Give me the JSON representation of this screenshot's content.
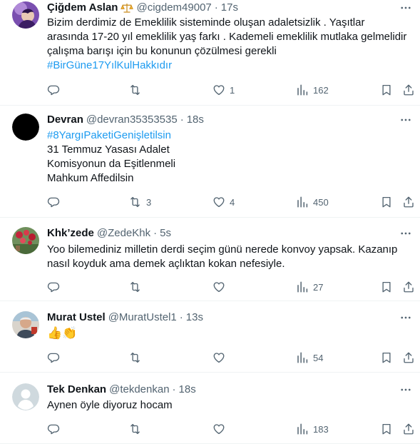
{
  "tweets": [
    {
      "name": "Çiğdem Aslan",
      "handle": "@cigdem49007",
      "time": "17s",
      "badge": "scales-icon",
      "avatar": "photo-purple",
      "lines": [
        {
          "text": "Bizim derdimiz de Emeklilik sisteminde oluşan adaletsizlik . Yaşıtlar",
          "tag": false
        },
        {
          "text": "arasında 17-20 yıl emeklilik yaş farkı . Kademeli emeklilik mutlaka gelmelidir",
          "tag": false
        },
        {
          "text": "çalışma barışı için bu konunun çözülmesi gerekli",
          "tag": false
        },
        {
          "text": "#BirGüne17YılKulHakkıdır",
          "tag": true
        }
      ],
      "replies": "",
      "retweets": "",
      "likes": "1",
      "views": "162"
    },
    {
      "name": "Devran",
      "handle": "@devran35353535",
      "time": "18s",
      "avatar": "black-circle",
      "lines": [
        {
          "text": "#8YargıPaketiGenişletilsin",
          "tag": true
        },
        {
          "text": "31 Temmuz Yasası Adalet",
          "tag": false
        },
        {
          "text": "Komisyonun da Eşitlenmeli",
          "tag": false
        },
        {
          "text": "Mahkum Affedilsin",
          "tag": false
        }
      ],
      "replies": "",
      "retweets": "3",
      "likes": "4",
      "views": "450"
    },
    {
      "name": "Khk’zede",
      "handle": "@ZedeKhk",
      "time": "5s",
      "avatar": "photo-flowers",
      "lines": [
        {
          "text": "Yoo bilemediniz milletin derdi seçim günü nerede konvoy yapsak. Kazanıp",
          "tag": false
        },
        {
          "text": "nasıl koyduk ama demek açlıktan kokan nefesiyle.",
          "tag": false
        }
      ],
      "replies": "",
      "retweets": "",
      "likes": "",
      "views": "27"
    },
    {
      "name": "Murat Ustel",
      "handle": "@MuratUstel1",
      "time": "13s",
      "avatar": "photo-man",
      "lines": [
        {
          "text": "👍👏",
          "tag": false
        }
      ],
      "replies": "",
      "retweets": "",
      "likes": "",
      "views": "54"
    },
    {
      "name": "Tek Denkan",
      "handle": "@tekdenkan",
      "time": "18s",
      "avatar": "default-profile",
      "lines": [
        {
          "text": "Aynen öyle diyoruz hocam",
          "tag": false
        }
      ],
      "replies": "",
      "retweets": "",
      "likes": "",
      "views": "183"
    }
  ],
  "icons": {
    "more": "more-dots-icon",
    "reply": "reply-icon",
    "retweet": "retweet-icon",
    "like": "heart-icon",
    "views": "analytics-icon",
    "bookmark": "bookmark-icon",
    "share": "share-icon"
  },
  "colors": {
    "text": "#0f1419",
    "secondary": "#536471",
    "link": "#1d9bf0",
    "divider": "#eff3f4"
  }
}
